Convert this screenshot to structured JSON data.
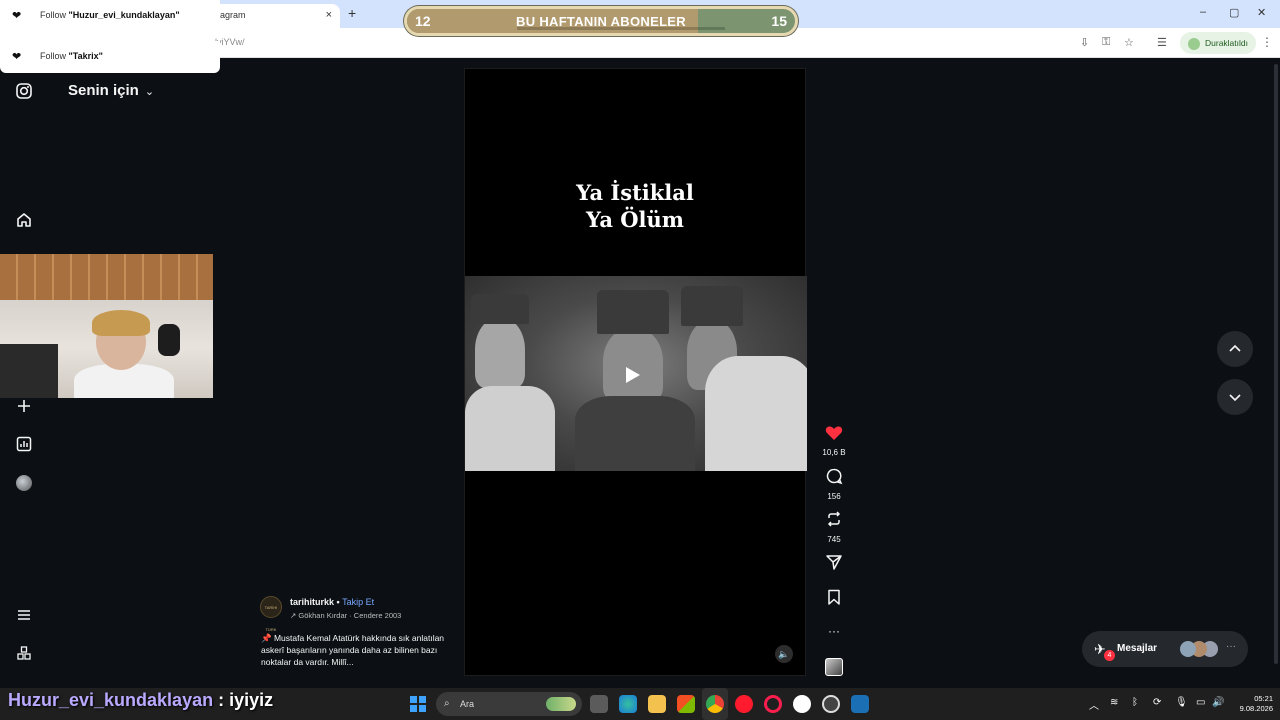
{
  "browser": {
    "tab_title": "agram",
    "tab_close": "×",
    "new_tab": "+",
    "url": "lyiYVw/",
    "paused_label": "Duraklatıldı",
    "window_controls": [
      "–",
      "▢",
      "✕"
    ]
  },
  "goal": {
    "title": "BU HAFTANIN ABONELER",
    "start": "12",
    "end": "15",
    "progress": 0.75,
    "colors": {
      "fill": "#b19a6d",
      "track": "#7c9570",
      "border": "#e6d9b2"
    }
  },
  "notifications": [
    {
      "prefix": "Follow ",
      "name": "\"Huzur_evi_kundaklayan\"",
      "icon": "heart-icon"
    },
    {
      "prefix": "Follow ",
      "name": "\"Takrix\"",
      "icon": "heart-icon"
    }
  ],
  "feed": {
    "title": "Senin için",
    "chevron": "⌄"
  },
  "sidebar_icons": [
    "instagram-icon",
    "home-icon",
    "create-icon",
    "dashboard-icon",
    "profile-avatar",
    "menu-icon",
    "more-apps-icon"
  ],
  "reel": {
    "title_line1": "Ya İstiklal",
    "title_line2": "Ya Ölüm",
    "mute_icon": "🔈"
  },
  "actions": {
    "likes": "10,6 B",
    "comments": "156",
    "reposts": "745",
    "like_color": "#ff3040"
  },
  "post": {
    "avatar_text": "TARİHİ TÜRK",
    "username": "tarihiturkk",
    "separator": " • ",
    "follow_label": "Takip Et",
    "audio": "↗ Gökhan Kırdar · Cendere 2003",
    "caption": "📌 Mustafa Kemal Atatürk hakkında sık anlatılan askerî başarıların yanında daha az bilinen bazı noktalar da vardır. Millî..."
  },
  "nav": {
    "up": "︿",
    "down": "﹀"
  },
  "messages": {
    "label": "Mesajlar",
    "badge": "4",
    "more": "···"
  },
  "chat": {
    "username": "Huzur_evi_kundaklayan",
    "message": " : iyiyiz"
  },
  "taskbar": {
    "search_placeholder": "Ara",
    "time": "05:21",
    "date": "9.08.2026",
    "apps": [
      "widgets",
      "file-explorer",
      "edge",
      "folder",
      "store",
      "chrome",
      "opera",
      "opera-gx",
      "yandex",
      "obs",
      "steam"
    ]
  }
}
